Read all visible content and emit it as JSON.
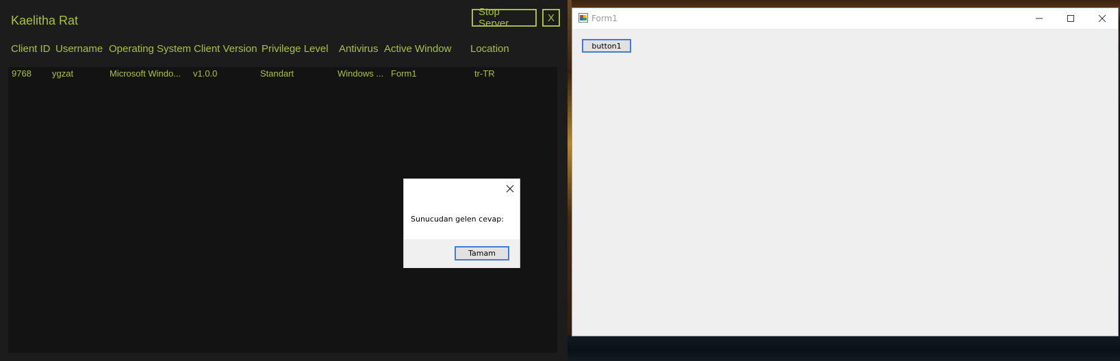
{
  "rat": {
    "title": "Kaelitha Rat",
    "stop_label": "Stop Server",
    "close_label": "X",
    "columns": [
      "Client ID",
      "Username",
      "Operating System",
      "Client Version",
      "Privilege Level",
      "Antivirus",
      "Active Window",
      "Location"
    ],
    "rows": [
      [
        "9768",
        "ygzat",
        "Microsoft Windo...",
        "v1.0.0",
        "Standart",
        "Windows ...",
        "Form1",
        "tr-TR"
      ]
    ],
    "accent": "#a8c23a"
  },
  "form1": {
    "title": "Form1",
    "button1_label": "button1"
  },
  "msgbox": {
    "text": "Sunucudan gelen cevap:",
    "ok_label": "Tamam"
  }
}
